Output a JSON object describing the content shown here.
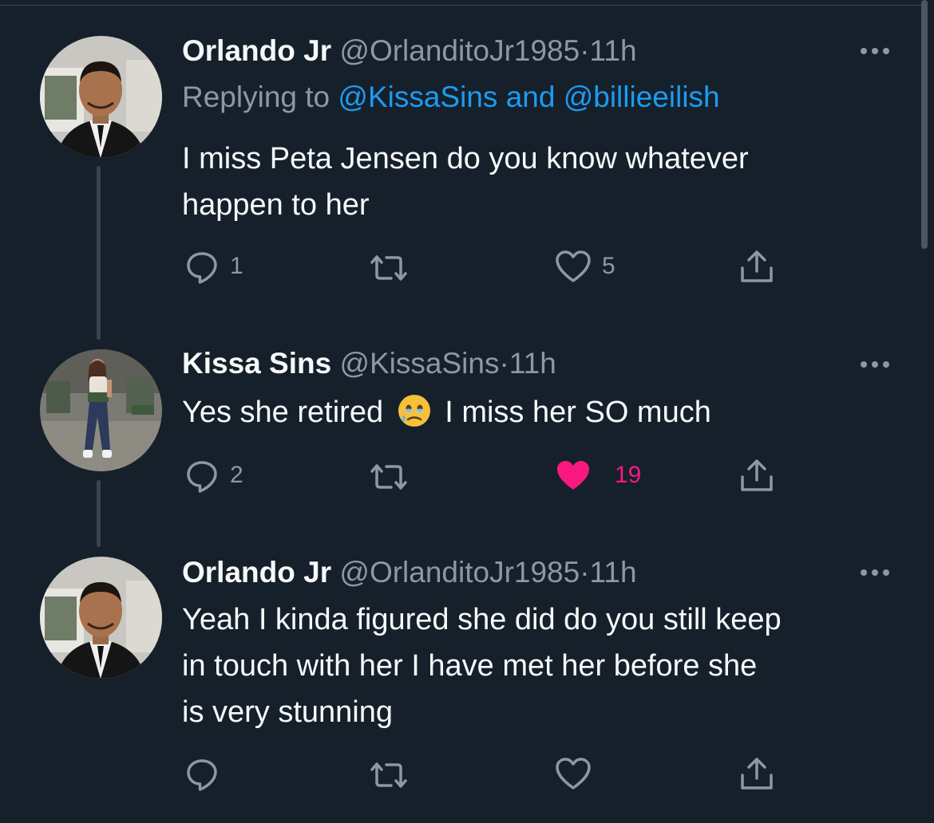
{
  "tweets": [
    {
      "name": "Orlando Jr",
      "handle": "@OrlanditoJr1985",
      "separator": "·",
      "time": "11h",
      "reply_prefix": "Replying to",
      "reply_user_1": "@KissaSins",
      "reply_and": "and",
      "reply_user_2": "@billieeilish",
      "text_line_1": "I miss Peta Jensen do you know whatever",
      "text_line_2": "happen to her",
      "reply_count": "1",
      "retweet_count": "",
      "like_count": "5",
      "liked": false
    },
    {
      "name": "Kissa Sins",
      "handle": "@KissaSins",
      "separator": "·",
      "time": "11h",
      "text_before_emoji": "Yes she retired",
      "emoji": "face-holding-back-tears",
      "text_after_emoji": "I miss her SO much",
      "reply_count": "2",
      "retweet_count": "",
      "like_count": "19",
      "liked": true
    },
    {
      "name": "Orlando Jr",
      "handle": "@OrlanditoJr1985",
      "separator": "·",
      "time": "11h",
      "text_line_1": "Yeah I kinda figured she did do you still keep",
      "text_line_2": "in touch with her I have met her before she",
      "text_line_3": "is very stunning",
      "reply_count": "",
      "retweet_count": "",
      "like_count": "",
      "liked": false
    }
  ],
  "colors": {
    "background": "#15202b",
    "primary_text": "#f7f9f9",
    "secondary_text": "#8b98a5",
    "link": "#1d9bf0",
    "like_active": "#f91880",
    "thread_line": "#38444d"
  },
  "icons": {
    "reply": "reply-icon",
    "retweet": "retweet-icon",
    "like": "heart-icon",
    "share": "share-icon",
    "more": "more-icon"
  }
}
